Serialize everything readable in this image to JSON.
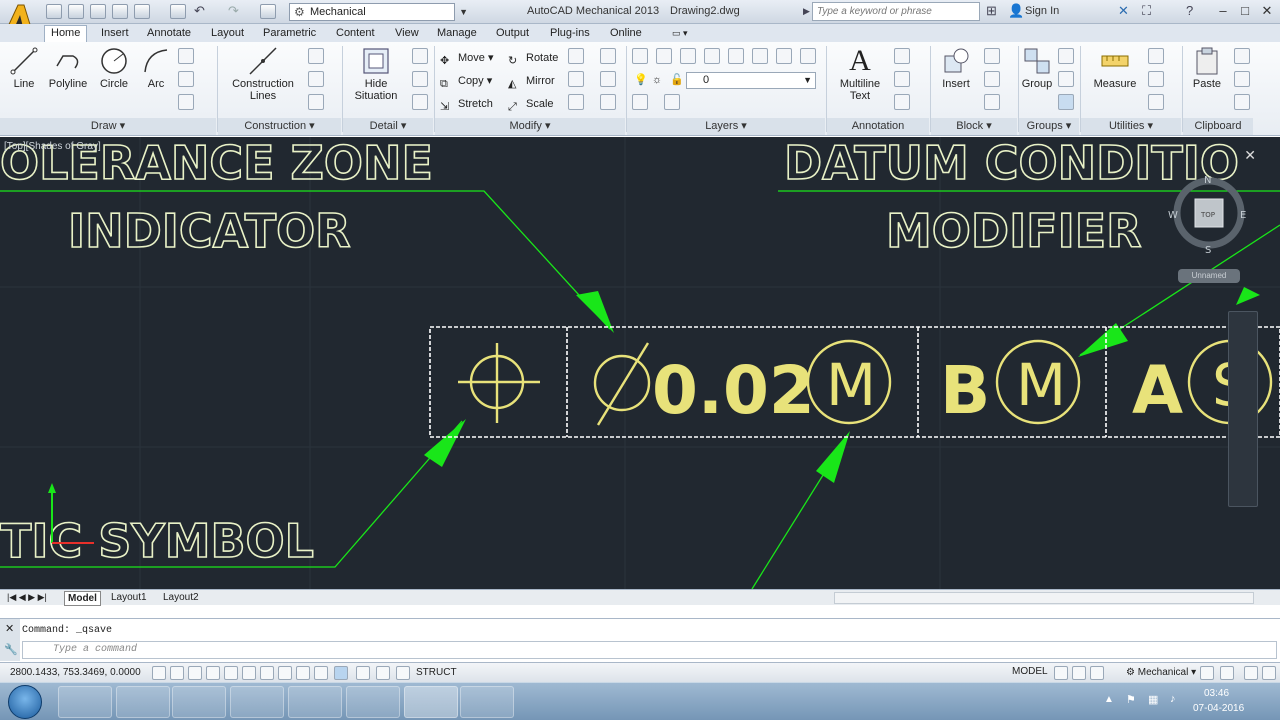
{
  "titlebar": {
    "workspace": "Mechanical",
    "app_title": "AutoCAD Mechanical 2013",
    "doc_title": "Drawing2.dwg",
    "search_placeholder": "Type a keyword or phrase",
    "signin": "Sign In",
    "logo_letter": "M"
  },
  "tabs": [
    "Home",
    "Insert",
    "Annotate",
    "Layout",
    "Parametric",
    "Content",
    "View",
    "Manage",
    "Output",
    "Plug-ins",
    "Online"
  ],
  "ribbon": {
    "draw": {
      "title": "Draw",
      "buttons": [
        "Line",
        "Polyline",
        "Circle",
        "Arc"
      ]
    },
    "construction": {
      "title": "Construction",
      "button": [
        "Construction",
        "Lines"
      ]
    },
    "detail": {
      "title": "Detail",
      "button": [
        "Hide",
        "Situation"
      ]
    },
    "modify": {
      "title": "Modify",
      "items": [
        "Move",
        "Rotate",
        "Copy",
        "Mirror",
        "Stretch",
        "Scale"
      ]
    },
    "layers": {
      "title": "Layers",
      "current_layer": "0"
    },
    "annotation": {
      "title": "Annotation",
      "button": [
        "Multiline",
        "Text"
      ]
    },
    "block": {
      "title": "Block",
      "button": "Insert"
    },
    "groups": {
      "title": "Groups",
      "button": "Group"
    },
    "utilities": {
      "title": "Utilities",
      "button": "Measure"
    },
    "clipboard": {
      "title": "Clipboard",
      "button": "Paste"
    }
  },
  "viewport": {
    "label": "[Top][Shades of Gray]",
    "label_tolerance_1": "OLERANCE ZONE",
    "label_tolerance_2": "INDICATOR",
    "label_datum_1": "DATUM CONDITIO",
    "label_datum_2": "MODIFIER",
    "label_symbol": "TIC SYMBOL",
    "fcf_value": "0.02",
    "fcf_mod_1": "M",
    "fcf_datum_b": "B",
    "fcf_mod_2": "M",
    "fcf_datum_a": "A",
    "fcf_mod_3": "S",
    "viewcube_top": "TOP",
    "compass_n": "N",
    "compass_s": "S",
    "compass_e": "E",
    "compass_w": "W",
    "wcs_label": "Unnamed"
  },
  "layout_tabs": [
    "Model",
    "Layout1",
    "Layout2"
  ],
  "command": {
    "history": "Command: _qsave",
    "placeholder": "Type a command"
  },
  "statusbar": {
    "coords": "2800.1433, 753.3469, 0.0000",
    "struct": "STRUCT",
    "model": "MODEL",
    "workspace": "Mechanical"
  },
  "taskbar": {
    "time": "03:46",
    "date": "07-04-2016"
  },
  "colors": {
    "canvas_bg": "#212830",
    "drawing_text": "#e9f2c7",
    "fcf_yellow": "#e8e27a",
    "leader_green": "#19e619"
  }
}
